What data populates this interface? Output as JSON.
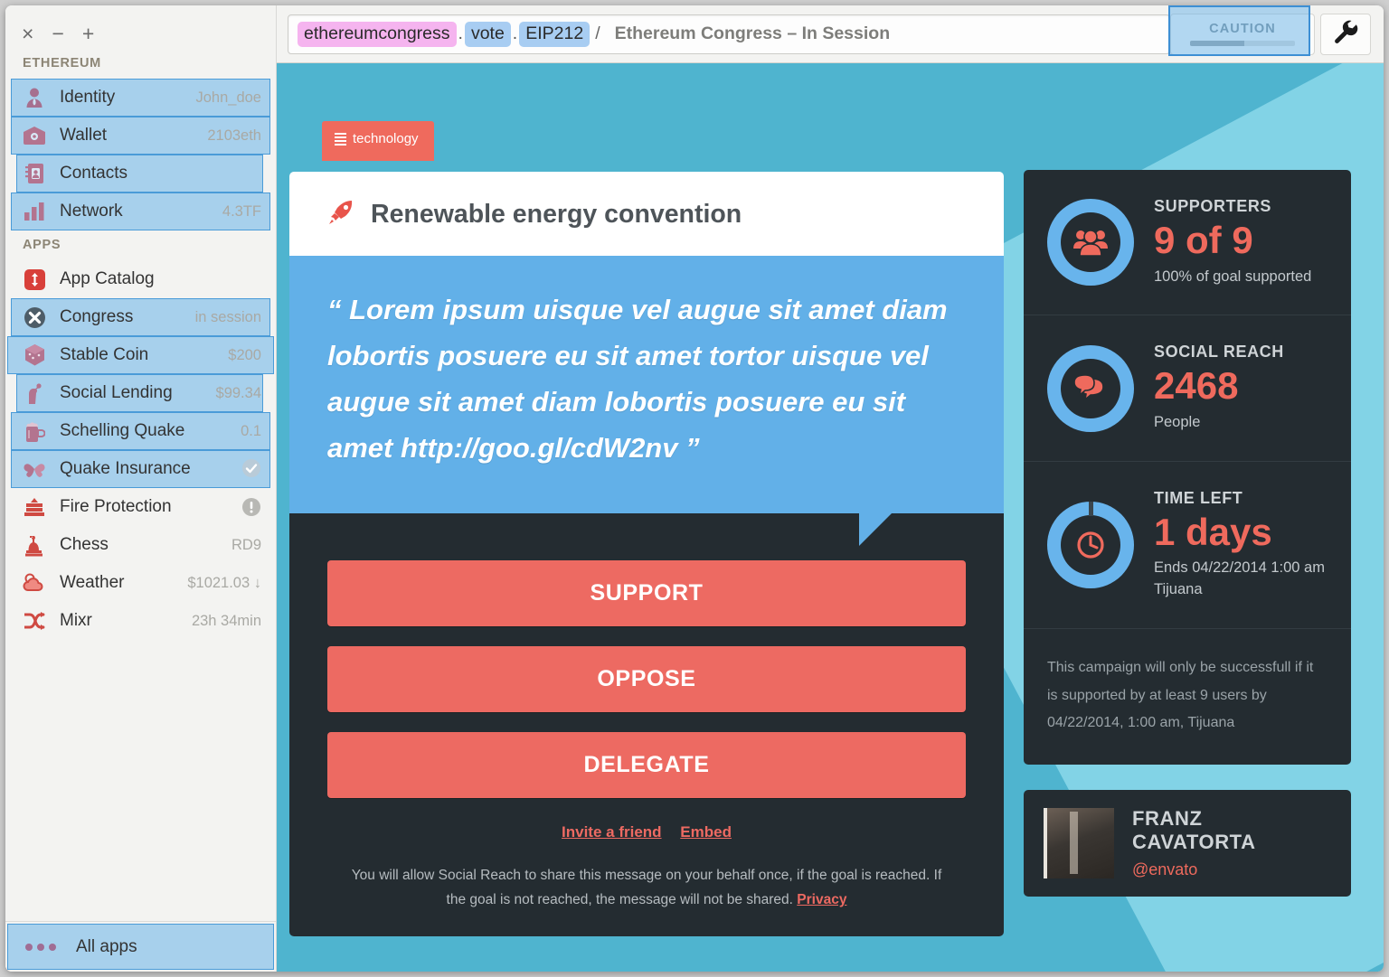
{
  "window": {
    "controls": [
      "×",
      "−",
      "+"
    ]
  },
  "sidebar": {
    "section_ethereum": "ETHEREUM",
    "section_apps": "APPS",
    "ethereum_items": [
      {
        "label": "Identity",
        "meta": "John_doe",
        "icon": "person-icon",
        "highlight": true
      },
      {
        "label": "Wallet",
        "meta": "2103eth",
        "icon": "wallet-icon",
        "highlight": true
      },
      {
        "label": "Contacts",
        "meta": "",
        "icon": "contacts-book-icon",
        "highlight": true
      },
      {
        "label": "Network",
        "meta": "4.3TF",
        "icon": "bar-chart-icon",
        "highlight": true
      }
    ],
    "app_items": [
      {
        "label": "App Catalog",
        "meta": "",
        "icon": "app-catalog-icon",
        "highlight": false
      },
      {
        "label": "Congress",
        "meta": "in session",
        "icon": "congress-x-icon",
        "highlight": true
      },
      {
        "label": "Stable Coin",
        "meta": "$200",
        "icon": "dice-cube-icon",
        "highlight": true
      },
      {
        "label": "Social Lending",
        "meta": "$99.34",
        "icon": "piggy-icon",
        "highlight": true
      },
      {
        "label": "Schelling Quake",
        "meta": "0.1",
        "icon": "beer-mug-icon",
        "highlight": true
      },
      {
        "label": "Quake Insurance",
        "meta": "✔",
        "icon": "butterfly-icon",
        "highlight": true
      },
      {
        "label": "Fire Protection",
        "meta": "!",
        "icon": "fire-hydrant-icon",
        "highlight": false
      },
      {
        "label": "Chess",
        "meta": "RD9",
        "icon": "chess-rook-icon",
        "highlight": false
      },
      {
        "label": "Weather",
        "meta": "$1021.03 ↓",
        "icon": "weather-cloud-icon",
        "highlight": false
      },
      {
        "label": "Mixr",
        "meta": "23h 34min",
        "icon": "shuffle-icon",
        "highlight": false
      }
    ],
    "all_apps_label": "All apps"
  },
  "topbar": {
    "url_parts": [
      {
        "text": "ethereumcongress",
        "style": "pink"
      },
      {
        "text": ".",
        "style": "sep"
      },
      {
        "text": "vote",
        "style": "blue"
      },
      {
        "text": ".",
        "style": "sep"
      },
      {
        "text": "EIP212",
        "style": "blue"
      }
    ],
    "slash": "/",
    "page_title": "Ethereum Congress – In Session",
    "caution_label": "CAUTION",
    "caution_progress": 52,
    "wrench_icon": "wrench-icon"
  },
  "main": {
    "tag_label": "technology",
    "card_title": "Renewable energy convention",
    "rocket_icon": "rocket-icon",
    "quote": "“ Lorem ipsum uisque vel augue sit amet diam lobortis posuere eu sit amet tortor uisque vel augue sit amet diam lobortis posuere eu sit amet http://goo.gl/cdW2nv ”",
    "buttons": [
      {
        "label": "SUPPORT"
      },
      {
        "label": "OPPOSE"
      },
      {
        "label": "DELEGATE"
      }
    ],
    "links": [
      {
        "label": "Invite a friend"
      },
      {
        "label": "Embed"
      }
    ],
    "disclaimer_text": "You will allow Social Reach to share this message on your behalf once, if the goal is reached. If the goal is not reached, the message will not be shared.",
    "privacy_label": "Privacy"
  },
  "rail": {
    "stats": [
      {
        "label": "SUPPORTERS",
        "value": "9 of 9",
        "sub": "100% of goal supported",
        "icon": "people-group-icon",
        "ring_gap": false
      },
      {
        "label": "SOCIAL REACH",
        "value": "2468",
        "sub": "People",
        "icon": "speech-bubbles-icon",
        "ring_gap": false
      },
      {
        "label": "TIME LEFT",
        "value": "1 days",
        "sub": "Ends 04/22/2014 1:00 am Tijuana",
        "icon": "clock-icon",
        "ring_gap": true
      }
    ],
    "note": "This campaign will only be successfull if it is supported by at least 9 users by 04/22/2014, 1:00 am, Tijuana",
    "author_name": "FRANZ CAVATORTA",
    "author_handle": "@envato"
  },
  "colors": {
    "accent_red": "#ef6a5d",
    "accent_blue": "#68b4ec",
    "bg_cyan": "#4fb4cf",
    "bg_cyan_light": "#82d3e6",
    "panel_dark": "#242c31",
    "highlight_blue": "#4a9bd8"
  }
}
